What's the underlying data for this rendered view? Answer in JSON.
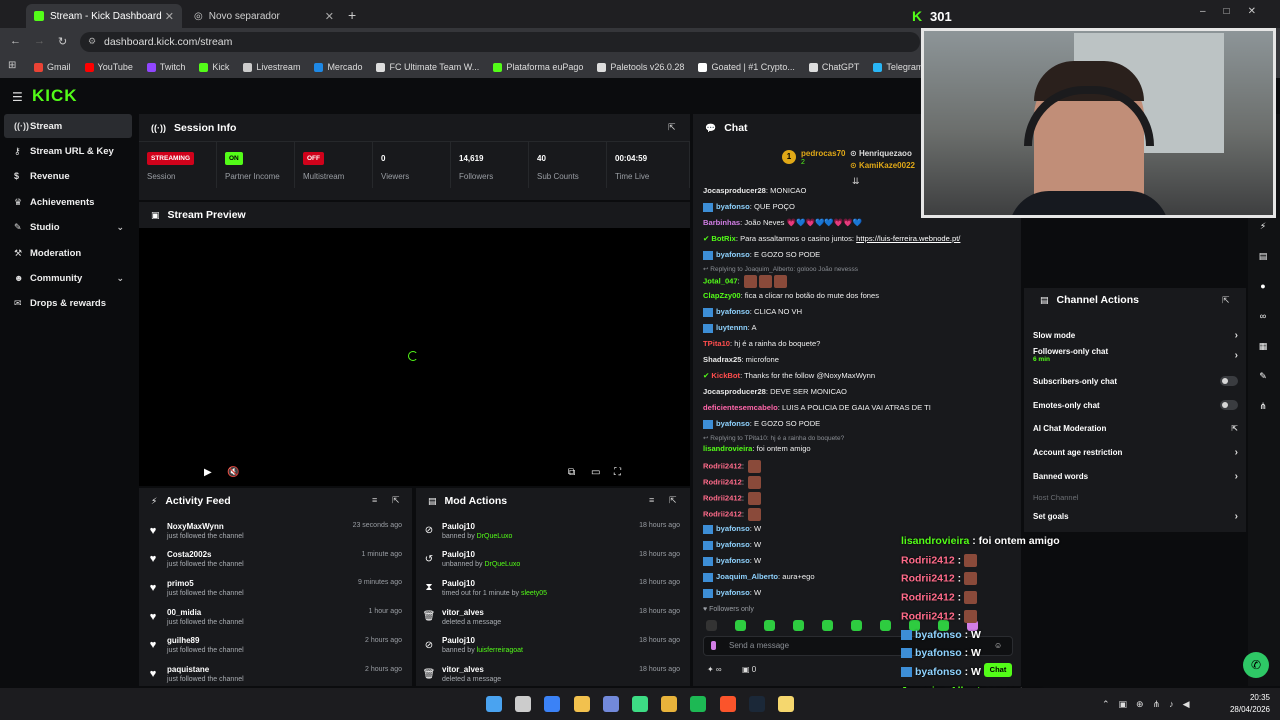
{
  "browser": {
    "tabs": [
      {
        "label": "Stream - Kick Dashboard"
      },
      {
        "label": "Novo separador"
      }
    ],
    "url": "dashboard.kick.com/stream",
    "bookmarks": [
      "Gmail",
      "YouTube",
      "Twitch",
      "Kick",
      "Livestream",
      "Mercado",
      "FC Ultimate Team W...",
      "Plataforma euPago",
      "Paletools v26.0.28",
      "Goated | #1 Crypto...",
      "ChatGPT",
      "Telegram",
      "Meus ativos - C"
    ]
  },
  "logo": "KICK",
  "viewer_count_overlay": "301",
  "sidebar": {
    "items": [
      {
        "label": "Stream"
      },
      {
        "label": "Stream URL & Key"
      },
      {
        "label": "Revenue"
      },
      {
        "label": "Achievements"
      },
      {
        "label": "Studio"
      },
      {
        "label": "Moderation"
      },
      {
        "label": "Community"
      },
      {
        "label": "Drops & rewards"
      }
    ]
  },
  "session": {
    "title": "Session Info",
    "stats": [
      {
        "badge": "STREAMING",
        "label": "Session"
      },
      {
        "badge": "ON",
        "label": "Partner Income"
      },
      {
        "badge": "OFF",
        "label": "Multistream"
      },
      {
        "value": "0",
        "label": "Viewers"
      },
      {
        "value": "14,619",
        "label": "Followers"
      },
      {
        "value": "40",
        "label": "Sub Counts"
      },
      {
        "value": "00:04:59",
        "label": "Time Live"
      }
    ]
  },
  "preview": {
    "title": "Stream Preview"
  },
  "activity": {
    "title": "Activity Feed",
    "rows": [
      {
        "name": "NoxyMaxWynn",
        "sub": "just followed the channel",
        "time": "23 seconds ago"
      },
      {
        "name": "Costa2002s",
        "sub": "just followed the channel",
        "time": "1 minute ago"
      },
      {
        "name": "primo5",
        "sub": "just followed the channel",
        "time": "9 minutes ago"
      },
      {
        "name": "00_midia",
        "sub": "just followed the channel",
        "time": "1 hour ago"
      },
      {
        "name": "guilhe89",
        "sub": "just followed the channel",
        "time": "2 hours ago"
      },
      {
        "name": "paquistane",
        "sub": "just followed the channel",
        "time": "2 hours ago"
      }
    ]
  },
  "mod": {
    "title": "Mod Actions",
    "rows": [
      {
        "name": "Pauloj10",
        "pre": "banned by ",
        "by": "DrQueLuxo",
        "time": "18 hours ago"
      },
      {
        "name": "Pauloj10",
        "pre": "unbanned by ",
        "by": "DrQueLuxo",
        "time": "18 hours ago"
      },
      {
        "name": "Pauloj10",
        "pre": "timed out for 1 minute by ",
        "by": "sleety05",
        "time": "18 hours ago"
      },
      {
        "name": "vitor_alves",
        "pre": "deleted a message",
        "by": "",
        "time": "18 hours ago"
      },
      {
        "name": "Pauloj10",
        "pre": "banned by ",
        "by": "luisferreiragoat",
        "time": "18 hours ago"
      },
      {
        "name": "vitor_alves",
        "pre": "deleted a message",
        "by": "",
        "time": "18 hours ago"
      }
    ]
  },
  "chat": {
    "title": "Chat",
    "top": {
      "u1": "pedrocas70",
      "n1": "2",
      "u2": "Henriquezaoo",
      "u3": "KamiKaze0022"
    },
    "messages": [
      {
        "user": "Jocasproducer28",
        "text": "MONICAO",
        "color": "#e8e8e8"
      },
      {
        "user": "byafonso",
        "text": "QUE POÇO",
        "color": "#8fd3ff"
      },
      {
        "user": "Barbinhas",
        "text": "João Neves 💗💙💗💙💙💗💗💙",
        "color": "#d27ee6"
      },
      {
        "user": "BotRix",
        "text": "Para assaltarmos o casino juntos: ",
        "link": "https://luis-ferreira.webnode.pt/",
        "color": "#53fc18"
      },
      {
        "user": "byafonso",
        "text": "E GOZO SO PODE",
        "color": "#8fd3ff"
      },
      {
        "reply": "Replying to Joaquim_Alberto: golooo João nevesss"
      },
      {
        "user": "Jotal_047",
        "text": "",
        "color": "#53fc18"
      },
      {
        "user": "ClapZzy00",
        "text": "fica a clicar no botão do mute dos fones",
        "color": "#53fc18"
      },
      {
        "user": "byafonso",
        "text": "CLICA NO VH",
        "color": "#8fd3ff"
      },
      {
        "user": "luytennn",
        "text": "A",
        "color": "#8fd3ff"
      },
      {
        "user": "TPita10",
        "text": "hj é a rainha do boquete?",
        "color": "#ff4d4d"
      },
      {
        "user": "Shadrax25",
        "text": "microfone",
        "color": "#e8e8e8"
      },
      {
        "user": "KickBot",
        "text": "Thanks for the follow @NoxyMaxWynn",
        "color": "#ff4d4d"
      },
      {
        "user": "Jocasproducer28",
        "text": "DEVE SER MONICAO",
        "color": "#e8e8e8"
      },
      {
        "user": "deficientesemcabelo",
        "text": "LUIS A POLICIA DE GAIA VAI ATRAS DE TI",
        "color": "#ff66aa"
      },
      {
        "user": "byafonso",
        "text": "E GOZO SO PODE",
        "color": "#8fd3ff"
      },
      {
        "reply": "Replying to TPita10: hj é a rainha do boquete?"
      },
      {
        "user": "lisandrovieira",
        "text": "foi ontem amigo",
        "color": "#53fc18"
      },
      {
        "user": "Rodrii2412",
        "text": "",
        "color": "#ff6b8a"
      },
      {
        "user": "Rodrii2412",
        "text": "",
        "color": "#ff6b8a"
      },
      {
        "user": "Rodrii2412",
        "text": "",
        "color": "#ff6b8a"
      },
      {
        "user": "Rodrii2412",
        "text": "",
        "color": "#ff6b8a"
      },
      {
        "user": "byafonso",
        "text": "W",
        "color": "#8fd3ff"
      },
      {
        "user": "byafonso",
        "text": "W",
        "color": "#8fd3ff"
      },
      {
        "user": "byafonso",
        "text": "W",
        "color": "#8fd3ff"
      },
      {
        "user": "Joaquim_Alberto",
        "text": "aura+ego",
        "color": "#8fd3ff"
      },
      {
        "user": "byafonso",
        "text": "W",
        "color": "#8fd3ff"
      }
    ],
    "followers_only": "Followers only",
    "placeholder": "Send a message",
    "count": "0",
    "send": "Chat"
  },
  "channel_actions": {
    "title": "Channel Actions",
    "items": [
      {
        "label": "Slow mode",
        "ctrl": "chev"
      },
      {
        "label": "Followers-only chat",
        "sub": "6 min",
        "ctrl": "chev"
      },
      {
        "label": "Subscribers-only chat",
        "ctrl": "toggle"
      },
      {
        "label": "Emotes-only chat",
        "ctrl": "toggle"
      },
      {
        "label": "AI Chat Moderation",
        "ctrl": "ext"
      },
      {
        "label": "Account age restriction",
        "ctrl": "chev"
      },
      {
        "label": "Banned words",
        "ctrl": "chev"
      },
      {
        "label": "Host Channel",
        "ctrl": "none",
        "dim": true
      },
      {
        "label": "Set goals",
        "ctrl": "chev"
      }
    ]
  },
  "overlay_chat": [
    {
      "user": "lisandrovieira",
      "text": "foi ontem amigo",
      "color": "#53fc18"
    },
    {
      "user": "Rodrii2412",
      "text": "",
      "color": "#ff6b8a"
    },
    {
      "user": "Rodrii2412",
      "text": "",
      "color": "#ff6b8a"
    },
    {
      "user": "Rodrii2412",
      "text": "",
      "color": "#ff6b8a"
    },
    {
      "user": "Rodrii2412",
      "text": "",
      "color": "#ff6b8a"
    },
    {
      "user": "byafonso",
      "text": "W",
      "color": "#8fd3ff"
    },
    {
      "user": "byafonso",
      "text": "W",
      "color": "#8fd3ff"
    },
    {
      "user": "byafonso",
      "text": "W",
      "color": "#8fd3ff"
    },
    {
      "user": "Joaquim_Alberto",
      "text": "aura+ego",
      "color": "#53fc18"
    }
  ],
  "clock": {
    "time": "20:35",
    "date": "28/04/2026"
  },
  "colors": {
    "kick_green": "#53fc18",
    "streaming_red": "#d0021b"
  }
}
